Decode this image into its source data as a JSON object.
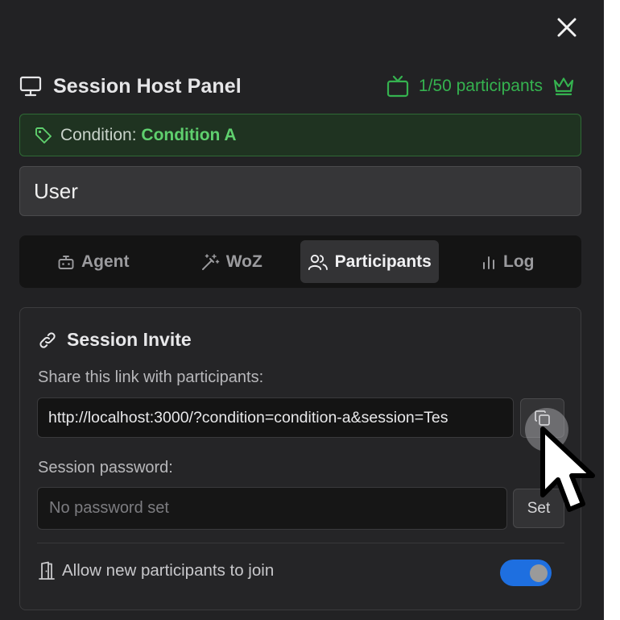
{
  "header": {
    "title": "Session Host Panel",
    "participant_count": "1/50 participants"
  },
  "condition": {
    "label": "Condition:",
    "value": "Condition A"
  },
  "user_field": {
    "value": "User"
  },
  "tabs": [
    {
      "label": "Agent",
      "icon": "robot-icon",
      "active": false
    },
    {
      "label": "WoZ",
      "icon": "magic-wand-icon",
      "active": false
    },
    {
      "label": "Participants",
      "icon": "users-icon",
      "active": true
    },
    {
      "label": "Log",
      "icon": "bar-chart-icon",
      "active": false
    }
  ],
  "invite": {
    "title": "Session Invite",
    "share_label": "Share this link with participants:",
    "link": "http://localhost:3000/?condition=condition-a&session=Tes",
    "password_label": "Session password:",
    "password_placeholder": "No password set",
    "set_label": "Set",
    "allow_label": "Allow new participants to join",
    "allow_enabled": true
  },
  "colors": {
    "accent_green": "#35b24f",
    "condition_green": "#5fd06e",
    "toggle_blue": "#1e6fe0",
    "panel_bg": "#222224"
  }
}
